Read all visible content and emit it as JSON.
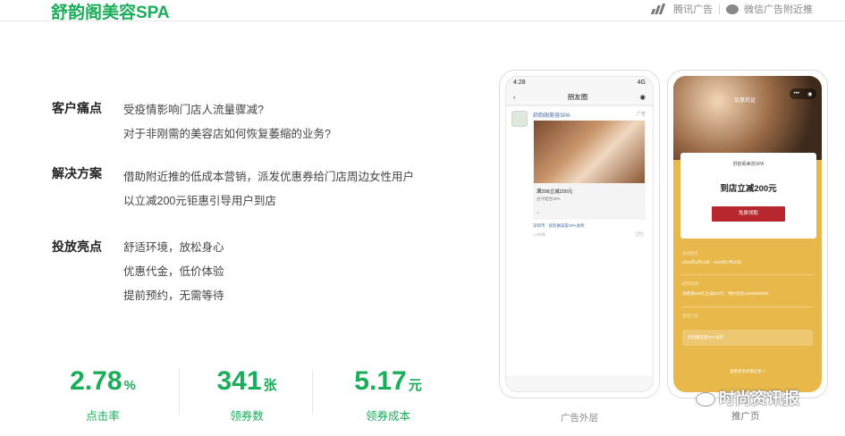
{
  "header": {
    "brand": "舒韵阁美容SPA",
    "tencent_ads": "腾讯广告",
    "wechat_ads": "微信广告附近推",
    "icons": [
      "tencent-ads-icon",
      "wechat-icon"
    ]
  },
  "sections": [
    {
      "title": "客户痛点",
      "lines": [
        "受疫情影响门店人流量骤减?",
        "对于非刚需的美容店如何恢复萎缩的业务?"
      ]
    },
    {
      "title": "解决方案",
      "lines": [
        "借助附近推的低成本营销，派发优惠券给门店周边女性用户",
        "以立减200元钜惠引导用户到店"
      ]
    },
    {
      "title": "投放亮点",
      "lines": [
        "舒适环境，放松身心",
        "优惠代金，低价体验",
        "提前预约，无需等待"
      ]
    }
  ],
  "stats": [
    {
      "value": "2.78",
      "unit": "%",
      "label": "点击率"
    },
    {
      "value": "341",
      "unit": "张",
      "label": "领券数"
    },
    {
      "value": "5.17",
      "unit": "元",
      "label": "领券成本"
    }
  ],
  "phone1": {
    "time": "4:28",
    "signal": "4G",
    "nav_title": "朋友圈",
    "back_icon": "back-arrow-icon",
    "camera_icon": "camera-icon",
    "post_name": "舒韵阁美容SPA",
    "ad_tag": "广告",
    "offer_title": "满298立减200元",
    "offer_sub": "古今结合SPA",
    "link_text": "深圳市 · 舒韵阁美容SPA会所",
    "time_text": "1小时前",
    "caption": "广告外层"
  },
  "phone2": {
    "header_label": "优惠凭证",
    "shop_name": "舒韵阁美容SPA",
    "offer": "到店立减200元",
    "button": "免费领取",
    "info": [
      {
        "label": "有效期至",
        "value": "2020年6月10日 - 2020年7月10日"
      },
      {
        "label": "使用说明",
        "value": "消费满298元立减200元，预约电话13600000000"
      },
      {
        "label": "适用门店",
        "value": ""
      }
    ],
    "store": "舒韵阁美容SPA会所",
    "bottom_link": "查看更多优惠信息 >",
    "caption": "推广页"
  },
  "watermark": "时尚资讯报"
}
